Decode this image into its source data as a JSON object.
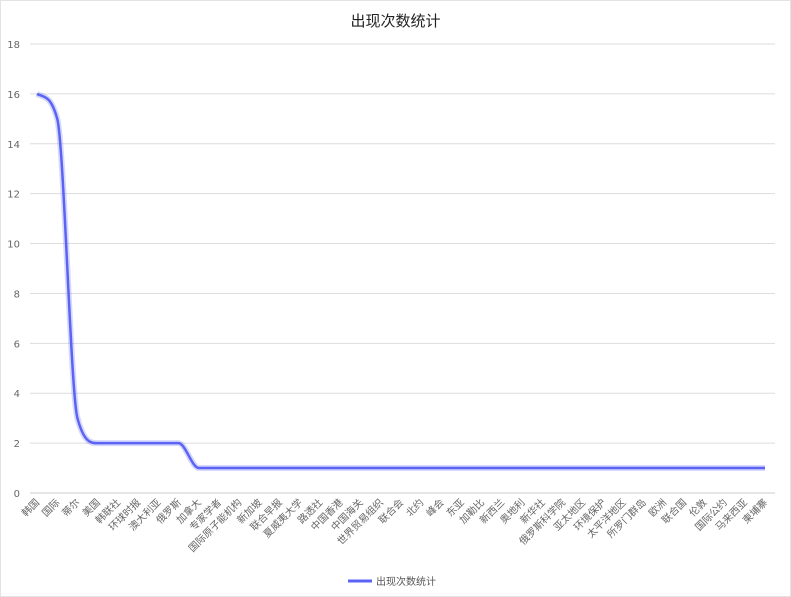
{
  "chart_data": {
    "type": "line",
    "title": "出现次数统计",
    "categories": [
      "韩国",
      "国际",
      "蒂尔",
      "美国",
      "韩联社",
      "环球时报",
      "澳大利亚",
      "俄罗斯",
      "加拿大",
      "专家学者",
      "国际原子能机构",
      "新加坡",
      "联合早报",
      "夏威夷大学",
      "路透社",
      "中国香港",
      "中国海关",
      "世界贸易组织",
      "联合会",
      "北约",
      "峰会",
      "东亚",
      "加勒比",
      "新西兰",
      "奥地利",
      "新华社",
      "俄罗斯科学院",
      "亚太地区",
      "环境保护",
      "太平洋地区",
      "所罗门群岛",
      "欧洲",
      "联合国",
      "伦敦",
      "国际公约",
      "马来西亚",
      "柬埔寨"
    ],
    "series": [
      {
        "name": "出现次数统计",
        "values": [
          16,
          15,
          3,
          2,
          2,
          2,
          2,
          2,
          1,
          1,
          1,
          1,
          1,
          1,
          1,
          1,
          1,
          1,
          1,
          1,
          1,
          1,
          1,
          1,
          1,
          1,
          1,
          1,
          1,
          1,
          1,
          1,
          1,
          1,
          1,
          1,
          1
        ]
      }
    ],
    "ylim": [
      0,
      18
    ],
    "yticks": [
      0,
      2,
      4,
      6,
      8,
      10,
      12,
      14,
      16,
      18
    ],
    "grid": true,
    "legend_position": "bottom",
    "colors": {
      "line": "#5b63f5",
      "grid": "#dddddd",
      "axis": "#cccccc"
    }
  }
}
